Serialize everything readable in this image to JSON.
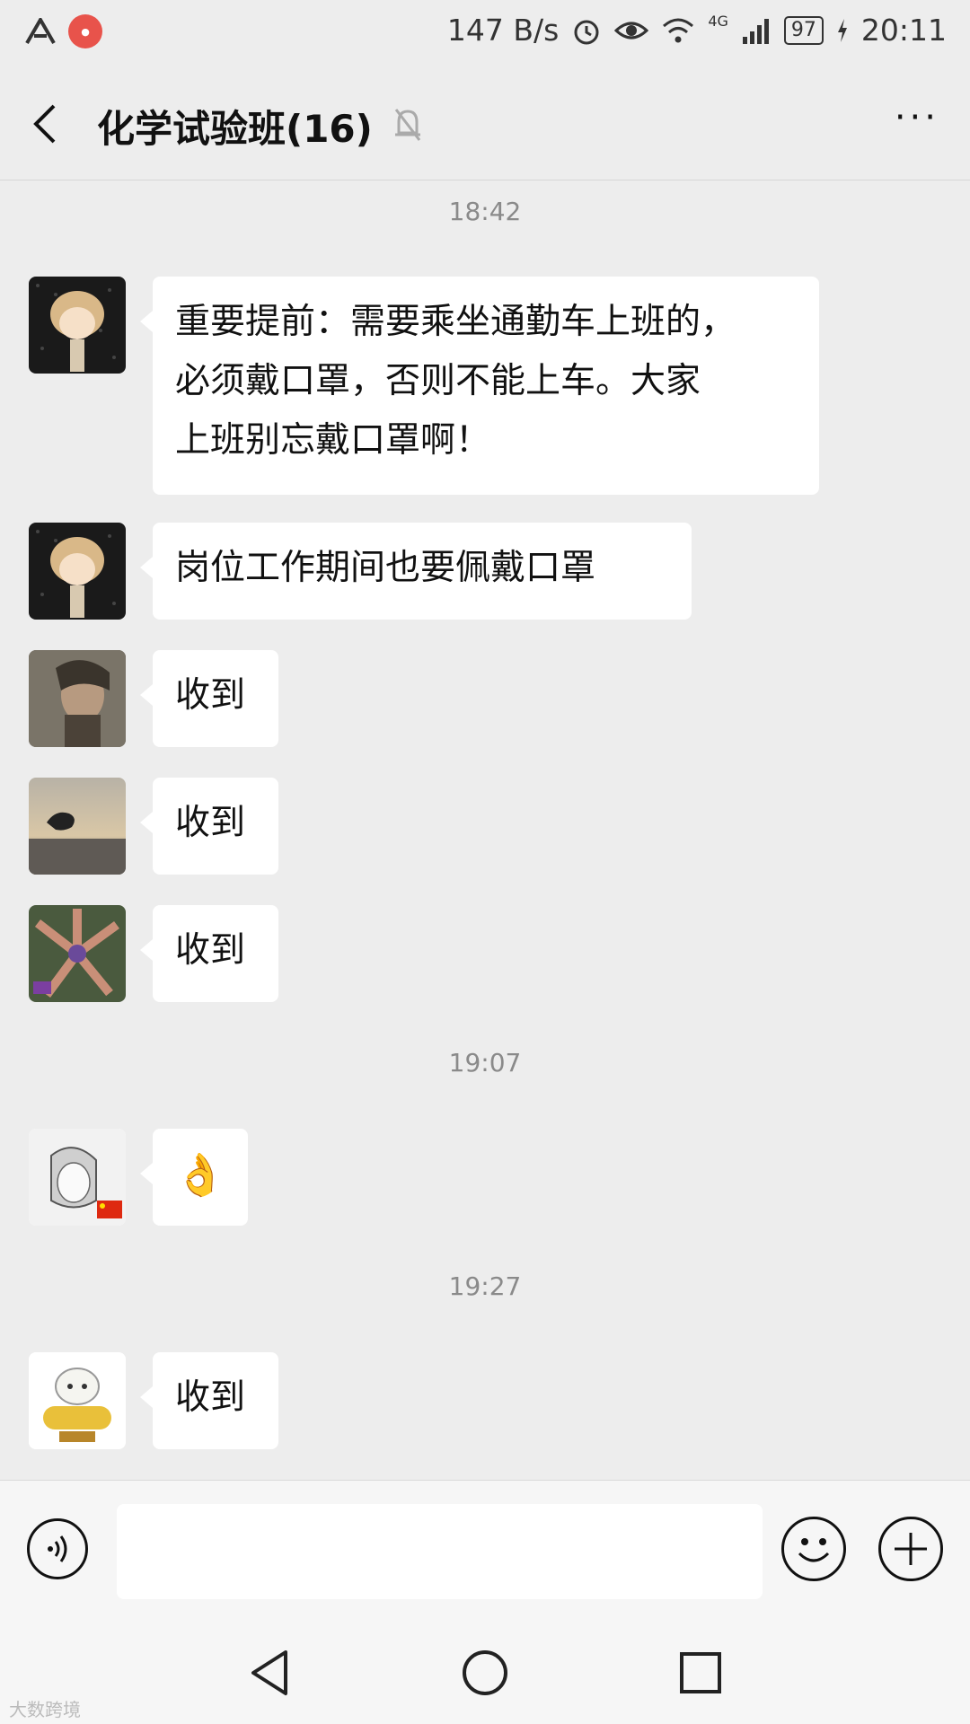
{
  "status_bar": {
    "network_speed": "147 B/s",
    "network_type": "4G",
    "battery": "97",
    "time": "20:11",
    "left_icons": [
      "app-logo-icon",
      "notification-badge-icon"
    ],
    "right_icons": [
      "alarm-icon",
      "eye-icon",
      "wifi-icon",
      "signal-icon",
      "battery-icon",
      "charging-icon"
    ]
  },
  "header": {
    "title": "化学试验班(16)",
    "back_icon": "back-arrow-icon",
    "mute_icon": "muted-bell-icon",
    "more_label": "···"
  },
  "chat": {
    "timestamps": [
      "18:42",
      "19:07",
      "19:27"
    ],
    "messages": [
      {
        "avatar": "cartoon-girl-avatar",
        "text": "重要提前：需要乘坐通勤车上班的，\n必须戴口罩，否则不能上车。大家\n上班别忘戴口罩啊！"
      },
      {
        "avatar": "cartoon-girl-avatar",
        "text": "岗位工作期间也要佩戴口罩"
      },
      {
        "avatar": "man-portrait-avatar",
        "text": "收到"
      },
      {
        "avatar": "sunset-hand-avatar",
        "text": "收到"
      },
      {
        "avatar": "hands-star-avatar",
        "text": "收到"
      },
      {
        "avatar": "sketch-girl-avatar",
        "text": "👌"
      },
      {
        "avatar": "sheep-cartoon-avatar",
        "text": "收到"
      }
    ]
  },
  "input_bar": {
    "text_value": "",
    "icons": [
      "voice-icon",
      "emoji-icon",
      "plus-icon"
    ]
  },
  "nav_bar": {
    "icons": [
      "nav-back-icon",
      "nav-home-icon",
      "nav-recents-icon"
    ]
  },
  "watermark": "大数跨境",
  "colors": {
    "background": "#ededed",
    "bubble": "#ffffff",
    "timestamp": "#8a8a8a"
  }
}
